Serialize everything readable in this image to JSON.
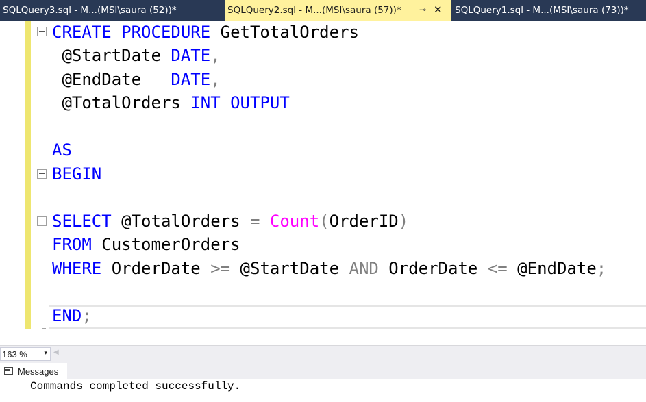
{
  "tabs": [
    {
      "label": "SQLQuery3.sql - M...(MSI\\saura (52))*"
    },
    {
      "label": "SQLQuery2.sql - M...(MSI\\saura (57))*",
      "pin": "⊸",
      "close": "✕"
    },
    {
      "label": "SQLQuery1.sql - M...(MSI\\saura (73))*"
    }
  ],
  "code": {
    "l1": {
      "kw": "CREATE PROCEDURE",
      "name": " GetTotalOrders"
    },
    "l2": {
      "param": " @StartDate ",
      "type": "DATE",
      "comma": ","
    },
    "l3": {
      "param": " @EndDate   ",
      "type": "DATE",
      "comma": ","
    },
    "l4": {
      "param": " @TotalOrders ",
      "type": "INT OUTPUT"
    },
    "l6": {
      "kw": "AS"
    },
    "l7": {
      "kw": "BEGIN"
    },
    "l9": {
      "kw": "SELECT",
      "var": " @TotalOrders ",
      "eq": "=",
      "sp": " ",
      "fn": "Count",
      "open": "(",
      "col": "OrderID",
      "close": ")"
    },
    "l10": {
      "kw": "FROM",
      "table": " CustomerOrders"
    },
    "l11": {
      "kw": "WHERE",
      "c1": " OrderDate ",
      "ge": ">=",
      "v1": " @StartDate ",
      "and": "AND",
      "c2": " OrderDate ",
      "le": "<=",
      "v2": " @EndDate",
      "semi": ";"
    },
    "l13": {
      "kw": "END",
      "semi": ";"
    }
  },
  "zoom": {
    "value": "163 %",
    "arrow": "▾"
  },
  "scroll_left": "◀",
  "messages": {
    "tab_label": "Messages",
    "text": "Commands completed successfully."
  },
  "colors": {
    "keyword": "#0000ff",
    "function": "#ff00ff",
    "operator": "#808080",
    "tab_active": "#fff29d",
    "tab_strip": "#293955",
    "change_bar": "#eee670"
  }
}
